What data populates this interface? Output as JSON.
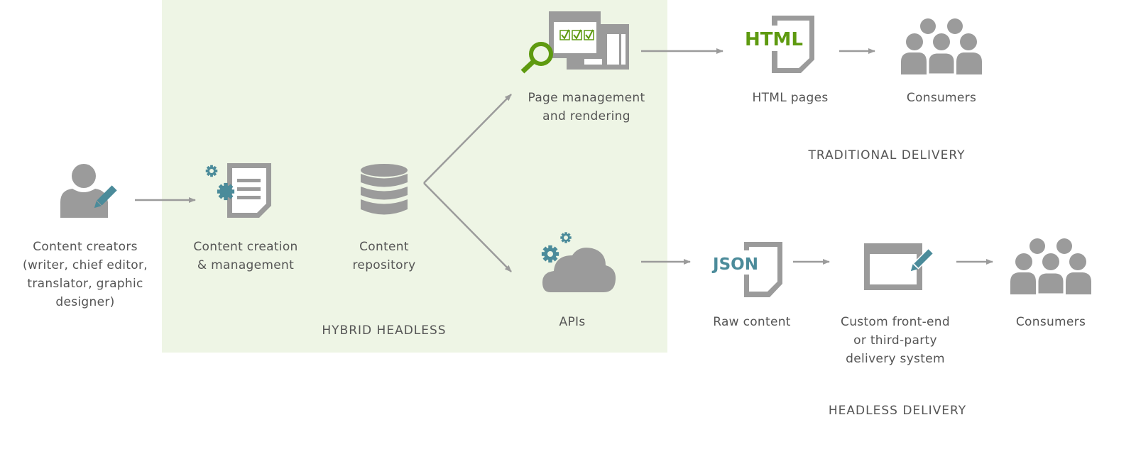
{
  "colors": {
    "panel": "#eef5e5",
    "icon_grey": "#9b9b9b",
    "teal": "#4b8b9a",
    "green": "#5e9a10",
    "text": "#555555"
  },
  "regions": {
    "hybrid": "HYBRID HEADLESS",
    "traditional": "TRADITIONAL DELIVERY",
    "headless": "HEADLESS DELIVERY"
  },
  "nodes": {
    "creators": {
      "label": "Content creators\n(writer, chief editor,\ntranslator, graphic\ndesigner)",
      "icon": "person-pencil-icon"
    },
    "creation": {
      "label": "Content creation\n& management",
      "icon": "gears-document-icon"
    },
    "repository": {
      "label": "Content\nrepository",
      "icon": "database-icon"
    },
    "page_mgmt": {
      "label": "Page management\nand rendering",
      "icon": "windows-magnifier-icon"
    },
    "html_pages": {
      "label": "HTML pages",
      "icon": "html-document-icon",
      "icon_text": "HTML"
    },
    "consumers_top": {
      "label": "Consumers",
      "icon": "people-group-icon"
    },
    "apis": {
      "label": "APIs",
      "icon": "cloud-gears-icon"
    },
    "raw_content": {
      "label": "Raw content",
      "icon": "json-document-icon",
      "icon_text": "JSON"
    },
    "frontend": {
      "label": "Custom front-end\nor third-party\ndelivery system",
      "icon": "window-pencil-icon"
    },
    "consumers_bottom": {
      "label": "Consumers",
      "icon": "people-group-icon"
    }
  }
}
